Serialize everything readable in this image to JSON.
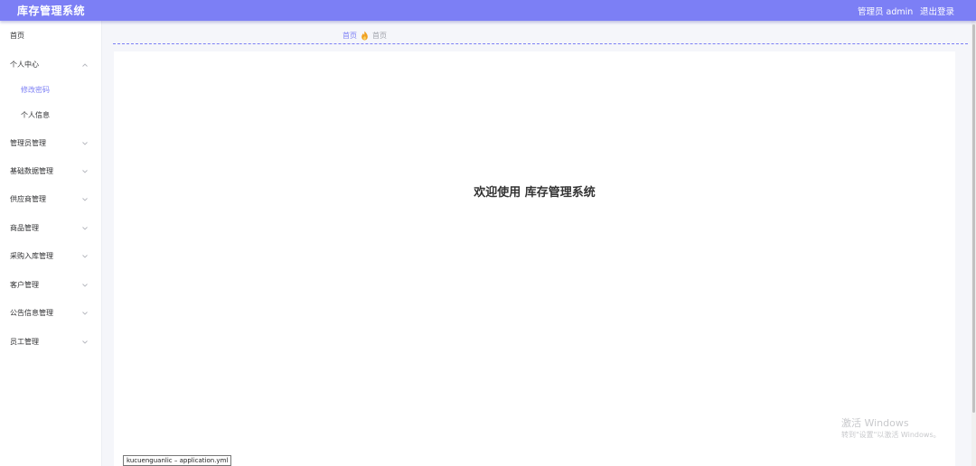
{
  "app": {
    "title": "库存管理系统",
    "user_label": "管理员 admin",
    "logout_label": "退出登录",
    "accent_color": "#7c7ff5"
  },
  "sidebar": {
    "items": [
      {
        "label": "首页",
        "has_arrow": false
      },
      {
        "label": "个人中心",
        "expanded": true,
        "has_arrow": true
      },
      {
        "label": "修改密码",
        "sub": true,
        "active": true
      },
      {
        "label": "个人信息",
        "sub": true
      },
      {
        "label": "管理员管理",
        "has_arrow": true
      },
      {
        "label": "基础数据管理",
        "has_arrow": true
      },
      {
        "label": "供应商管理",
        "has_arrow": true
      },
      {
        "label": "商品管理",
        "has_arrow": true
      },
      {
        "label": "采购入库管理",
        "has_arrow": true
      },
      {
        "label": "客户管理",
        "has_arrow": true
      },
      {
        "label": "公告信息管理",
        "has_arrow": true
      },
      {
        "label": "员工管理",
        "has_arrow": true
      }
    ]
  },
  "breadcrumb": {
    "home": "首页",
    "separator_icon": "fire-icon",
    "current": "首页"
  },
  "main": {
    "welcome": "欢迎使用 库存管理系统"
  },
  "watermark": {
    "line1": "激活 Windows",
    "line2": "转到\"设置\"以激活 Windows。"
  },
  "tooltip": {
    "text": "kucuenguanlic – application.yml"
  }
}
